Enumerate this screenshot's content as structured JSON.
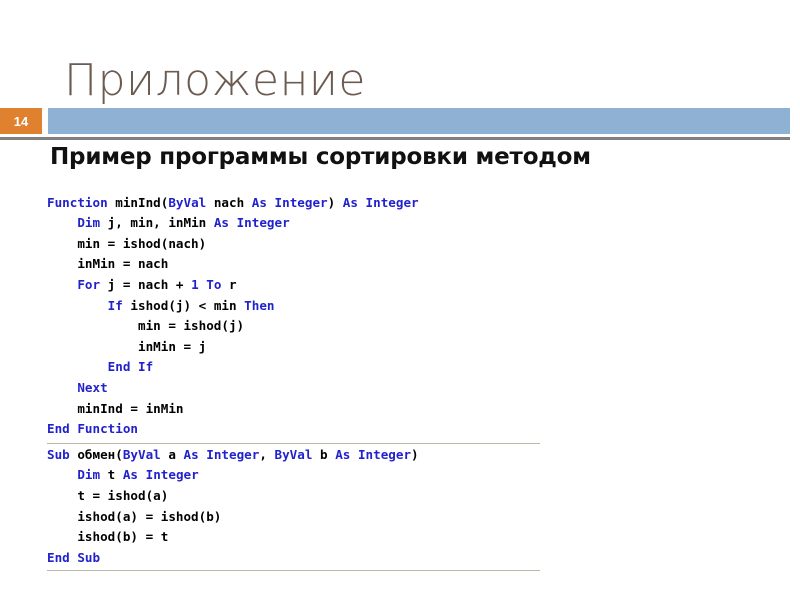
{
  "slide": {
    "title": "Приложение",
    "number": "14",
    "subtitle": "Пример программы сортировки методом",
    "colors": {
      "title_text": "#6b5b51",
      "badge_background": "#e0812f",
      "badge_text": "#ffffff",
      "accent_bar": "#8fb2d4",
      "rule": "#808080",
      "code_keyword": "#2222cc",
      "code_identifier": "#000000",
      "code_separator": "#b9b9a8",
      "background": "#ffffff"
    }
  },
  "code_blocks": [
    {
      "name": "function-minind",
      "lines": [
        [
          {
            "t": "Function",
            "c": "kw"
          },
          {
            "t": " ",
            "c": "id"
          },
          {
            "t": "minInd(",
            "c": "id"
          },
          {
            "t": "ByVal",
            "c": "kw"
          },
          {
            "t": " nach ",
            "c": "id"
          },
          {
            "t": "As",
            "c": "kw"
          },
          {
            "t": " ",
            "c": "id"
          },
          {
            "t": "Integer",
            "c": "kw"
          },
          {
            "t": ") ",
            "c": "id"
          },
          {
            "t": "As",
            "c": "kw"
          },
          {
            "t": " ",
            "c": "id"
          },
          {
            "t": "Integer",
            "c": "kw"
          }
        ],
        [
          {
            "t": "    ",
            "c": "id"
          },
          {
            "t": "Dim",
            "c": "kw"
          },
          {
            "t": " j, min, inMin ",
            "c": "id"
          },
          {
            "t": "As",
            "c": "kw"
          },
          {
            "t": " ",
            "c": "id"
          },
          {
            "t": "Integer",
            "c": "kw"
          }
        ],
        [
          {
            "t": "    min = ishod(nach)",
            "c": "id"
          }
        ],
        [
          {
            "t": "    inMin = nach",
            "c": "id"
          }
        ],
        [
          {
            "t": "    ",
            "c": "id"
          },
          {
            "t": "For",
            "c": "kw"
          },
          {
            "t": " j = nach + ",
            "c": "id"
          },
          {
            "t": "1",
            "c": "num2"
          },
          {
            "t": " ",
            "c": "id"
          },
          {
            "t": "To",
            "c": "kw"
          },
          {
            "t": " r",
            "c": "id"
          }
        ],
        [
          {
            "t": "        ",
            "c": "id"
          },
          {
            "t": "If",
            "c": "kw"
          },
          {
            "t": " ishod(j) < min ",
            "c": "id"
          },
          {
            "t": "Then",
            "c": "kw"
          }
        ],
        [
          {
            "t": "            min = ishod(j)",
            "c": "id"
          }
        ],
        [
          {
            "t": "            inMin = j",
            "c": "id"
          }
        ],
        [
          {
            "t": "        ",
            "c": "id"
          },
          {
            "t": "End If",
            "c": "kw"
          }
        ],
        [
          {
            "t": "    ",
            "c": "id"
          },
          {
            "t": "Next",
            "c": "kw"
          }
        ],
        [
          {
            "t": "    minInd = inMin",
            "c": "id"
          }
        ],
        [
          {
            "t": "End Function",
            "c": "kw"
          }
        ]
      ]
    },
    {
      "name": "sub-obmen",
      "lines": [
        [
          {
            "t": "Sub",
            "c": "kw"
          },
          {
            "t": " обмен(",
            "c": "id"
          },
          {
            "t": "ByVal",
            "c": "kw"
          },
          {
            "t": " a ",
            "c": "id"
          },
          {
            "t": "As",
            "c": "kw"
          },
          {
            "t": " ",
            "c": "id"
          },
          {
            "t": "Integer",
            "c": "kw"
          },
          {
            "t": ", ",
            "c": "id"
          },
          {
            "t": "ByVal",
            "c": "kw"
          },
          {
            "t": " b ",
            "c": "id"
          },
          {
            "t": "As",
            "c": "kw"
          },
          {
            "t": " ",
            "c": "id"
          },
          {
            "t": "Integer",
            "c": "kw"
          },
          {
            "t": ")",
            "c": "id"
          }
        ],
        [
          {
            "t": "    ",
            "c": "id"
          },
          {
            "t": "Dim",
            "c": "kw"
          },
          {
            "t": " t ",
            "c": "id"
          },
          {
            "t": "As",
            "c": "kw"
          },
          {
            "t": " ",
            "c": "id"
          },
          {
            "t": "Integer",
            "c": "kw"
          }
        ],
        [
          {
            "t": "    t = ishod(a)",
            "c": "id"
          }
        ],
        [
          {
            "t": "    ishod(a) = ishod(b)",
            "c": "id"
          }
        ],
        [
          {
            "t": "    ishod(b) = t",
            "c": "id"
          }
        ],
        [
          {
            "t": "End Sub",
            "c": "kw"
          }
        ]
      ]
    }
  ]
}
